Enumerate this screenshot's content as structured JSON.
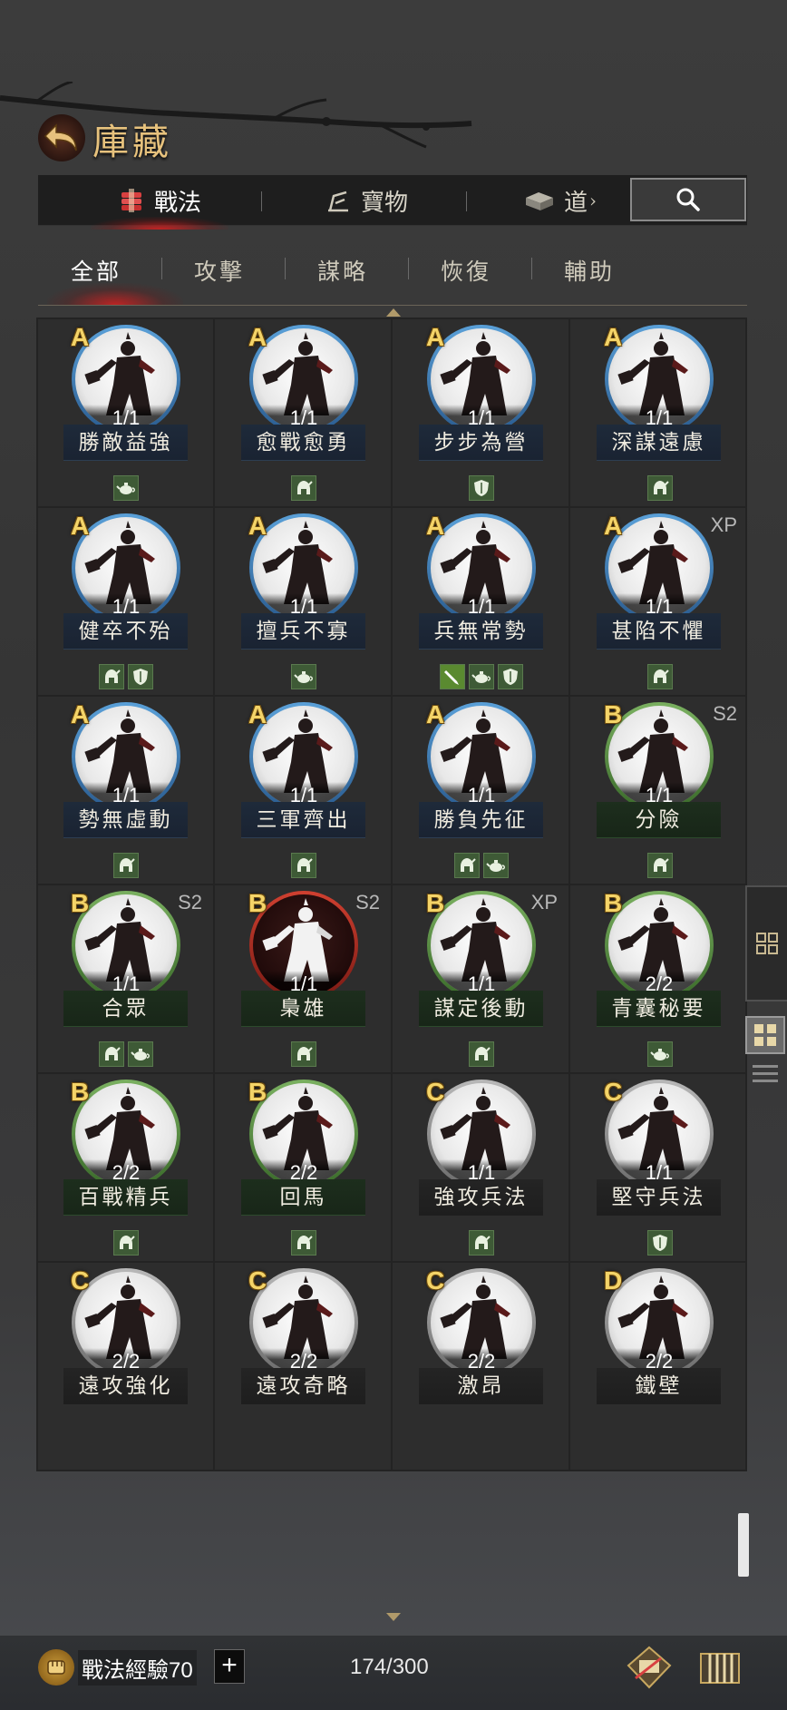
{
  "header": {
    "title": "庫藏",
    "main_tabs": [
      {
        "label": "戰法",
        "icon": "scroll-bundle-icon",
        "active": true
      },
      {
        "label": "寶物",
        "icon": "treasure-icon",
        "active": false
      },
      {
        "label": "道",
        "icon": "item-box-icon",
        "active": false
      }
    ],
    "sub_tabs": [
      {
        "label": "全部",
        "active": true
      },
      {
        "label": "攻擊",
        "active": false
      },
      {
        "label": "謀略",
        "active": false
      },
      {
        "label": "恢復",
        "active": false
      },
      {
        "label": "輔助",
        "active": false
      }
    ]
  },
  "skills": [
    [
      {
        "grade": "A",
        "name": "勝敵益強",
        "count": "1/1",
        "tag": "",
        "ring": "blue",
        "icons": [
          "teapot"
        ]
      },
      {
        "grade": "A",
        "name": "愈戰愈勇",
        "count": "1/1",
        "tag": "",
        "ring": "blue",
        "icons": [
          "helmet"
        ]
      },
      {
        "grade": "A",
        "name": "步步為營",
        "count": "1/1",
        "tag": "",
        "ring": "blue",
        "icons": [
          "shield"
        ]
      },
      {
        "grade": "A",
        "name": "深謀遠慮",
        "count": "1/1",
        "tag": "",
        "ring": "blue",
        "icons": [
          "helmet"
        ]
      }
    ],
    [
      {
        "grade": "A",
        "name": "健卒不殆",
        "count": "1/1",
        "tag": "",
        "ring": "blue",
        "icons": [
          "helmet",
          "shield"
        ]
      },
      {
        "grade": "A",
        "name": "擅兵不寡",
        "count": "1/1",
        "tag": "",
        "ring": "blue",
        "icons": [
          "teapot"
        ]
      },
      {
        "grade": "A",
        "name": "兵無常勢",
        "count": "1/1",
        "tag": "",
        "ring": "blue",
        "icons": [
          "blade",
          "teapot",
          "shield"
        ]
      },
      {
        "grade": "A",
        "name": "甚陷不懼",
        "count": "1/1",
        "tag": "XP",
        "ring": "blue",
        "icons": [
          "helmet"
        ]
      }
    ],
    [
      {
        "grade": "A",
        "name": "勢無虛動",
        "count": "1/1",
        "tag": "",
        "ring": "blue",
        "icons": [
          "helmet"
        ]
      },
      {
        "grade": "A",
        "name": "三軍齊出",
        "count": "1/1",
        "tag": "",
        "ring": "blue",
        "icons": [
          "helmet"
        ]
      },
      {
        "grade": "A",
        "name": "勝負先征",
        "count": "1/1",
        "tag": "",
        "ring": "blue",
        "icons": [
          "helmet",
          "teapot"
        ]
      },
      {
        "grade": "B",
        "name": "分險",
        "count": "1/1",
        "tag": "S2",
        "ring": "green",
        "icons": [
          "helmet"
        ]
      }
    ],
    [
      {
        "grade": "B",
        "name": "合眾",
        "count": "1/1",
        "tag": "S2",
        "ring": "green",
        "icons": [
          "helmet",
          "teapot"
        ]
      },
      {
        "grade": "B",
        "name": "梟雄",
        "count": "1/1",
        "tag": "S2",
        "ring": "red",
        "icons": [
          "helmet"
        ]
      },
      {
        "grade": "B",
        "name": "謀定後動",
        "count": "1/1",
        "tag": "XP",
        "ring": "green",
        "icons": [
          "helmet"
        ]
      },
      {
        "grade": "B",
        "name": "青囊秘要",
        "count": "2/2",
        "tag": "",
        "ring": "green",
        "icons": [
          "teapot"
        ]
      }
    ],
    [
      {
        "grade": "B",
        "name": "百戰精兵",
        "count": "2/2",
        "tag": "",
        "ring": "green",
        "icons": [
          "helmet"
        ]
      },
      {
        "grade": "B",
        "name": "回馬",
        "count": "2/2",
        "tag": "",
        "ring": "green",
        "icons": [
          "helmet"
        ]
      },
      {
        "grade": "C",
        "name": "強攻兵法",
        "count": "1/1",
        "tag": "",
        "ring": "gray",
        "icons": [
          "helmet"
        ]
      },
      {
        "grade": "C",
        "name": "堅守兵法",
        "count": "1/1",
        "tag": "",
        "ring": "gray",
        "icons": [
          "shield"
        ]
      }
    ],
    [
      {
        "grade": "C",
        "name": "遠攻強化",
        "count": "2/2",
        "tag": "",
        "ring": "gray",
        "icons": []
      },
      {
        "grade": "C",
        "name": "遠攻奇略",
        "count": "2/2",
        "tag": "",
        "ring": "gray",
        "icons": []
      },
      {
        "grade": "C",
        "name": "激昂",
        "count": "2/2",
        "tag": "",
        "ring": "gray",
        "icons": []
      },
      {
        "grade": "D",
        "name": "鐵壁",
        "count": "2/2",
        "tag": "",
        "ring": "gray",
        "icons": []
      }
    ]
  ],
  "footer": {
    "xp_label": "戰法經驗70",
    "plus_label": "+",
    "capacity": "174/300"
  },
  "colors": {
    "accent_gold": "#e7c27d",
    "tab_active_red": "#dc1e1e",
    "grade_yellow": "#f4d468"
  }
}
